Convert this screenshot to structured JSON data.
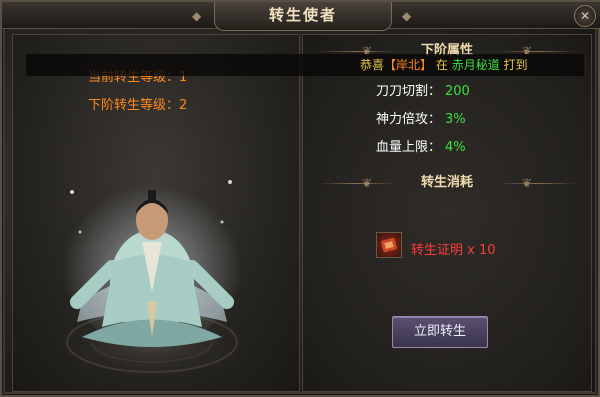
{
  "window": {
    "title": "转生使者"
  },
  "announcement": {
    "prefix": "恭喜",
    "player": "【岸北】",
    "middle": "在",
    "place": "赤月秘道",
    "suffix": "打到"
  },
  "left": {
    "current_level": "当前转生等级：1",
    "next_level": "下阶转生等级：2"
  },
  "right": {
    "next_attrs_title": "下阶属性",
    "attributes": [
      {
        "name": "刀刀切割：",
        "value": "200"
      },
      {
        "name": "神力倍攻：",
        "value": "3%"
      },
      {
        "name": "血量上限：",
        "value": "4%"
      }
    ],
    "cost_title": "转生消耗",
    "cost_item": "转生证明 x 10",
    "action_label": "立即转生"
  },
  "colors": {
    "level_text": "#ff8a1c",
    "attr_value": "#3ee03e",
    "cost_text": "#ff3a3a",
    "title_text": "#f2e2c0"
  },
  "icons": [
    "close-icon",
    "token-item-icon",
    "ornament-icon"
  ]
}
